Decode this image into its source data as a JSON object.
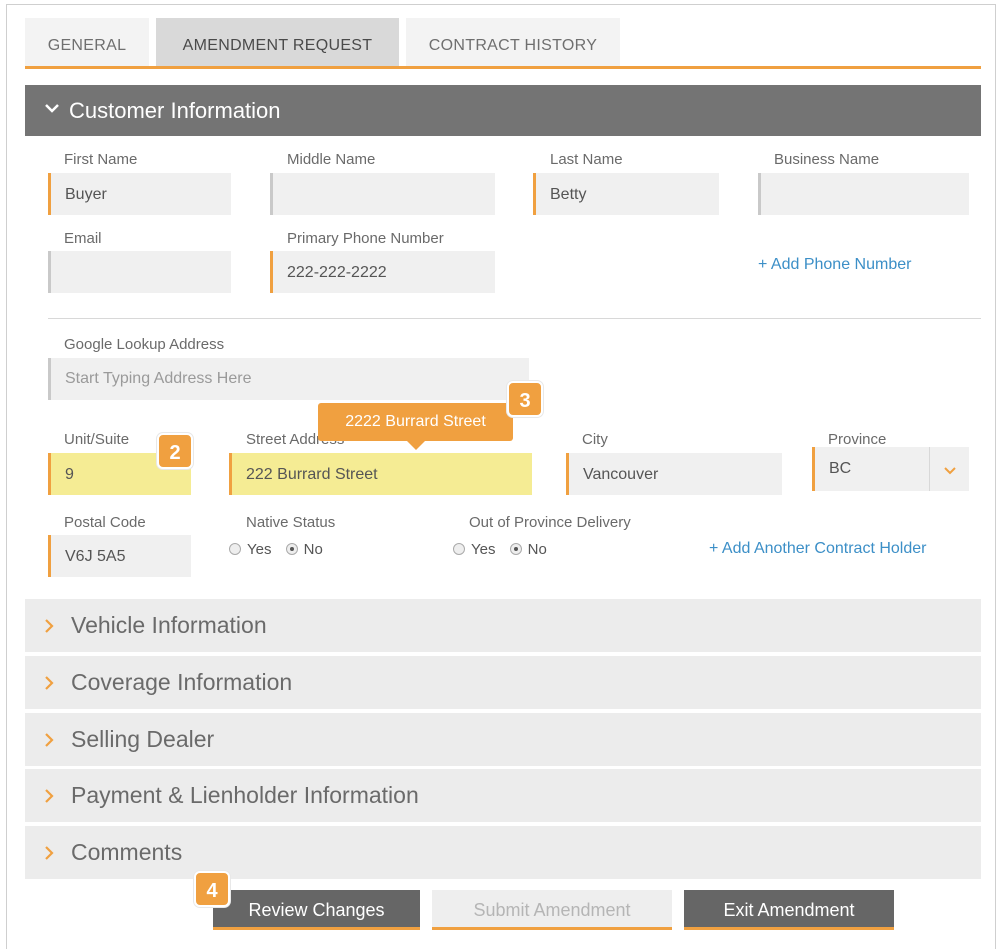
{
  "tabs": [
    "GENERAL",
    "AMENDMENT REQUEST",
    "CONTRACT HISTORY"
  ],
  "section_title": "Customer Information",
  "labels": {
    "first_name": "First Name",
    "middle_name": "Middle Name",
    "last_name": "Last Name",
    "business_name": "Business Name",
    "email": "Email",
    "primary_phone": "Primary Phone Number",
    "google_lookup": "Google Lookup Address",
    "unit_suite": "Unit/Suite",
    "street_address": "Street Address",
    "city": "City",
    "province": "Province",
    "postal_code": "Postal Code",
    "native_status": "Native Status",
    "out_of_province": "Out of Province Delivery"
  },
  "values": {
    "first_name": "Buyer",
    "middle_name": "",
    "last_name": "Betty",
    "business_name": "",
    "email": "",
    "primary_phone": "222-222-2222",
    "unit_suite": "9",
    "street_address": "222 Burrard Street",
    "city": "Vancouver",
    "province": "BC",
    "postal_code": "V6J 5A5"
  },
  "placeholders": {
    "google_lookup": "Start Typing Address Here"
  },
  "radio": {
    "yes": "Yes",
    "no": "No",
    "native_status_selected": "No",
    "out_of_province_selected": "No"
  },
  "links": {
    "add_phone": "+ Add Phone Number",
    "add_contract_holder": "+ Add Another Contract Holder"
  },
  "tooltip": "2222 Burrard Street",
  "badges": {
    "unit": "2",
    "street": "3",
    "review": "4"
  },
  "accordion": [
    "Vehicle Information",
    "Coverage Information",
    "Selling Dealer",
    "Payment & Lienholder Information",
    "Comments"
  ],
  "buttons": {
    "review": "Review Changes",
    "submit": "Submit Amendment",
    "exit": "Exit Amendment"
  },
  "colors": {
    "accent": "#f0a040",
    "header": "#747474",
    "highlight": "#f5ec94",
    "link": "#3c8fc7"
  }
}
